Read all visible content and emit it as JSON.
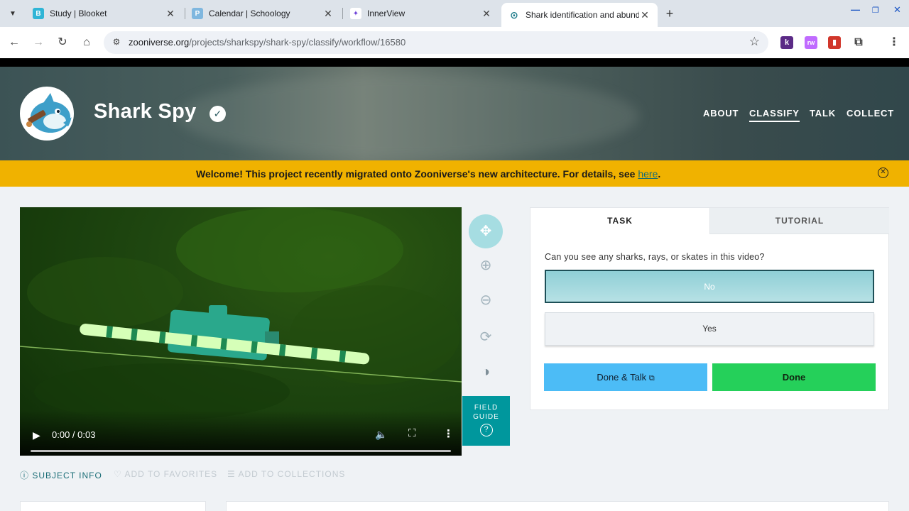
{
  "browser": {
    "tabs": [
      {
        "title": "Study | Blooket",
        "favicon": "B",
        "color": "#2fb5d6"
      },
      {
        "title": "Calendar | Schoology",
        "favicon": "P",
        "color": "#7fb7df"
      },
      {
        "title": "InnerView",
        "favicon": "✦",
        "color": "#6f44d8"
      },
      {
        "title": "Shark identification and abund",
        "favicon": "⊙",
        "color": "#1d7b8a"
      }
    ],
    "url_host": "zooniverse.org",
    "url_path": "/projects/sharkspy/shark-spy/classify/workflow/16580"
  },
  "project": {
    "title": "Shark Spy",
    "nav": [
      "ABOUT",
      "CLASSIFY",
      "TALK",
      "COLLECT"
    ]
  },
  "banner": {
    "text": "Welcome! This project recently migrated onto Zooniverse's new architecture. For details, see ",
    "link": "here",
    "end": "."
  },
  "video": {
    "time": "0:00 / 0:03"
  },
  "field_guide": {
    "label": "FIELD GUIDE"
  },
  "task": {
    "tab_task": "TASK",
    "tab_tutorial": "TUTORIAL",
    "question": "Can you see any sharks, rays, or skates in this video?",
    "answers": [
      "No",
      "Yes"
    ],
    "selected_answer": "No",
    "done_talk": "Done & Talk",
    "done": "Done"
  },
  "meta": {
    "subject_info": "SUBJECT INFO",
    "favorites": "ADD TO FAVORITES",
    "collections": "ADD TO COLLECTIONS"
  },
  "colors": {
    "accent_teal": "#00979d",
    "banner": "#f0b200",
    "done": "#25d05a",
    "done_talk": "#4cbcf6"
  }
}
